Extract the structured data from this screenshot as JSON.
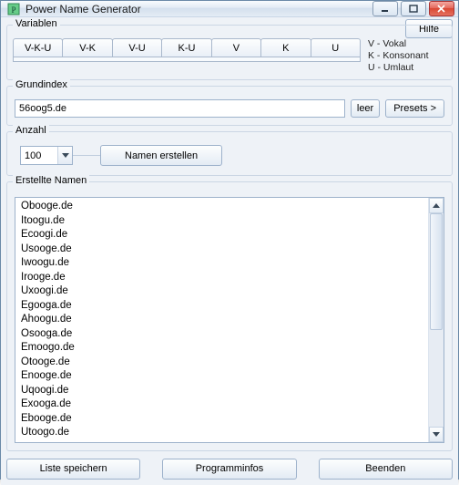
{
  "window": {
    "title": "Power Name Generator"
  },
  "buttons": {
    "help": "Hilfe",
    "clear": "leer",
    "presets": "Presets >",
    "generate": "Namen erstellen",
    "save_list": "Liste speichern",
    "info": "Programminfos",
    "exit": "Beenden"
  },
  "labels": {
    "variablen": "Variablen",
    "grundindex": "Grundindex",
    "anzahl": "Anzahl",
    "erstellte_namen": "Erstellte Namen"
  },
  "tabs": [
    "V-K-U",
    "V-K",
    "V-U",
    "K-U",
    "V",
    "K",
    "U"
  ],
  "legend": {
    "l1": "V - Vokal",
    "l2": "K - Konsonant",
    "l3": "U - Umlaut"
  },
  "grundindex_value": "56oog5.de",
  "anzahl_value": "100",
  "generated_names": [
    "Obooge.de",
    "Itoogu.de",
    "Ecoogi.de",
    "Usooge.de",
    "Iwoogu.de",
    "Irooge.de",
    "Uxoogi.de",
    "Egooga.de",
    "Ahoogu.de",
    "Osooga.de",
    "Emoogo.de",
    "Otooge.de",
    "Enooge.de",
    "Uqoogi.de",
    "Exooga.de",
    "Ebooge.de",
    "Utoogo.de"
  ]
}
